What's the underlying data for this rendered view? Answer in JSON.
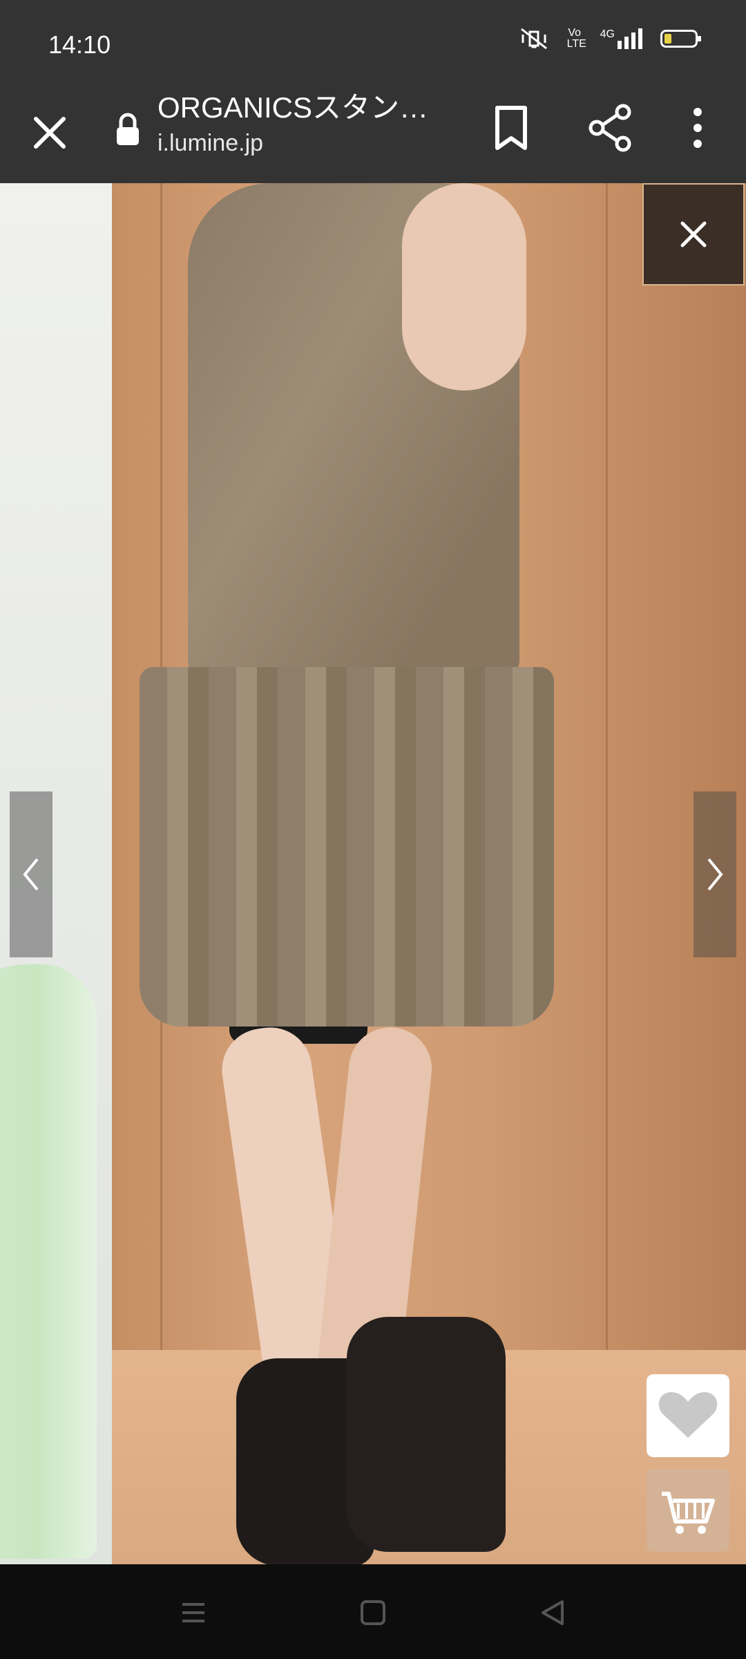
{
  "status_bar": {
    "time": "14:10",
    "icons": [
      "mute-vibrate-icon",
      "volte-icon",
      "4g-signal-icon",
      "battery-low-icon"
    ],
    "network_label": "4G",
    "volte_label": "Vo LTE"
  },
  "browser": {
    "title": "ORGANICSスタン…",
    "url": "i.lumine.jp",
    "actions": [
      "close-icon",
      "lock-icon",
      "bookmark-icon",
      "share-icon",
      "more-icon"
    ]
  },
  "gallery": {
    "close_label": "×",
    "prev_label": "‹",
    "next_label": "›",
    "favorite_icon": "heart-icon",
    "cart_icon": "cart-icon"
  },
  "colors": {
    "toolbar_bg": "#333333",
    "sysnav_bg": "#0d0d0d"
  },
  "system_nav": [
    "menu-icon",
    "home-icon",
    "back-icon"
  ]
}
